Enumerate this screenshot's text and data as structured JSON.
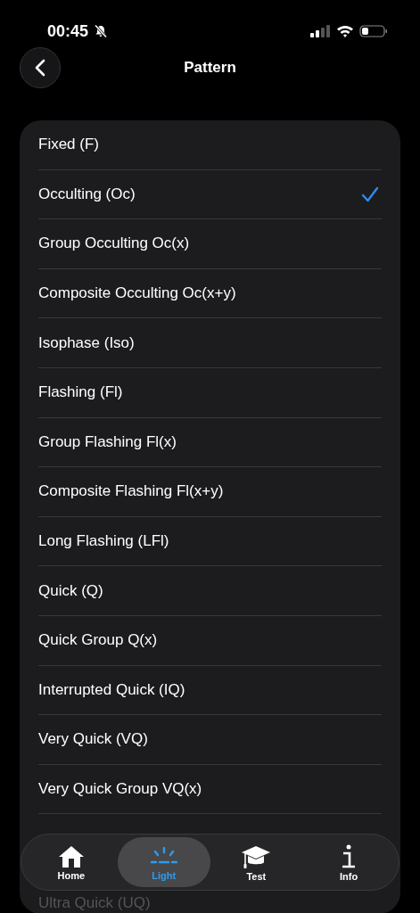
{
  "status_bar": {
    "time": "00:45",
    "silent": true
  },
  "nav": {
    "title": "Pattern"
  },
  "patterns": [
    {
      "label": "Fixed (F)",
      "selected": false
    },
    {
      "label": "Occulting (Oc)",
      "selected": true
    },
    {
      "label": "Group Occulting Oc(x)",
      "selected": false
    },
    {
      "label": "Composite Occulting Oc(x+y)",
      "selected": false
    },
    {
      "label": "Isophase (Iso)",
      "selected": false
    },
    {
      "label": "Flashing (Fl)",
      "selected": false
    },
    {
      "label": "Group Flashing Fl(x)",
      "selected": false
    },
    {
      "label": "Composite Flashing Fl(x+y)",
      "selected": false
    },
    {
      "label": "Long Flashing (LFl)",
      "selected": false
    },
    {
      "label": "Quick (Q)",
      "selected": false
    },
    {
      "label": "Quick Group Q(x)",
      "selected": false
    },
    {
      "label": "Interrupted Quick (IQ)",
      "selected": false
    },
    {
      "label": "Very Quick (VQ)",
      "selected": false
    },
    {
      "label": "Very Quick Group VQ(x)",
      "selected": false
    }
  ],
  "partly_hidden_pattern": {
    "label": "Ultra Quick (UQ)"
  },
  "tab_bar": [
    {
      "kind": "home",
      "label": "Home",
      "selected": false
    },
    {
      "kind": "light",
      "label": "Light",
      "selected": true
    },
    {
      "kind": "test",
      "label": "Test",
      "selected": false
    },
    {
      "kind": "info",
      "label": "Info",
      "selected": false
    }
  ]
}
